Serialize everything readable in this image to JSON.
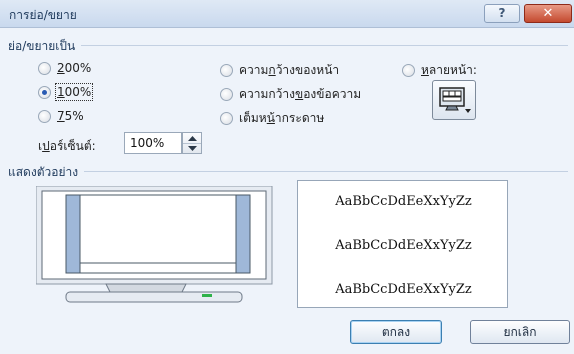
{
  "window": {
    "title": "การย่อ/ขยาย",
    "help_label": "?",
    "close_label": "✕"
  },
  "zoom_group": {
    "label": "ย่อ/ขยายเป็น",
    "options": [
      {
        "label_pre": "",
        "label_u": "2",
        "label_post": "00%",
        "selected": false
      },
      {
        "label_pre": "",
        "label_u": "1",
        "label_post": "00%",
        "selected": true
      },
      {
        "label_pre": "",
        "label_u": "7",
        "label_post": "5%",
        "selected": false
      },
      {
        "label_pre": "ความ",
        "label_u": "ก",
        "label_post": "ว้างของหน้า",
        "selected": false
      },
      {
        "label_pre": "ความกว้าง",
        "label_u": "ข",
        "label_post": "องข้อความ",
        "selected": false
      },
      {
        "label_pre": "เต็มห",
        "label_u": "น้",
        "label_post": "ากระดาษ",
        "selected": false
      },
      {
        "label_pre": "",
        "label_u": "ห",
        "label_post": "ลายหน้า:",
        "selected": false
      }
    ],
    "percent_label_pre": "เ",
    "percent_label_u": "ป",
    "percent_label_post": "อร์เซ็นต์:",
    "percent_value": "100%"
  },
  "preview_group": {
    "label": "แสดงตัวอย่าง",
    "sample_lines": [
      "AaBbCcDdEeXxYyZz",
      "AaBbCcDdEeXxYyZz",
      "AaBbCcDdEeXxYyZz"
    ]
  },
  "buttons": {
    "ok": "ตกลง",
    "cancel": "ยกเลิก"
  }
}
